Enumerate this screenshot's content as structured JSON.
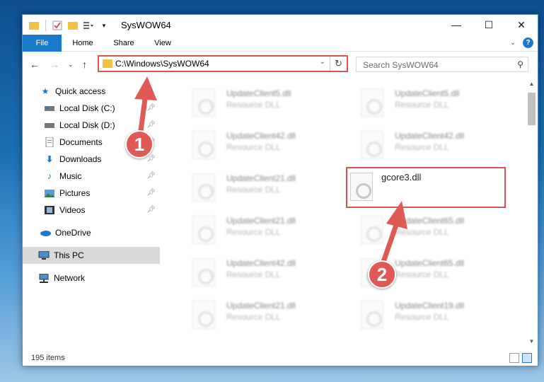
{
  "window": {
    "title": "SysWOW64"
  },
  "ribbon": {
    "tabs": [
      "File",
      "Home",
      "Share",
      "View"
    ]
  },
  "navigation": {
    "address": "C:\\Windows\\SysWOW64",
    "search_placeholder": "Search SysWOW64"
  },
  "sidebar": {
    "items": [
      {
        "label": "Quick access",
        "icon": "star-icon",
        "pinned": false
      },
      {
        "label": "Local Disk (C:)",
        "icon": "drive-icon",
        "pinned": true
      },
      {
        "label": "Local Disk (D:)",
        "icon": "drive-icon",
        "pinned": true
      },
      {
        "label": "Documents",
        "icon": "documents-icon",
        "pinned": true
      },
      {
        "label": "Downloads",
        "icon": "download-arrow-icon",
        "pinned": true
      },
      {
        "label": "Music",
        "icon": "music-note-icon",
        "pinned": true
      },
      {
        "label": "Pictures",
        "icon": "pictures-icon",
        "pinned": true
      },
      {
        "label": "Videos",
        "icon": "film-icon",
        "pinned": true
      },
      {
        "label": "OneDrive",
        "icon": "cloud-icon",
        "pinned": false
      },
      {
        "label": "This PC",
        "icon": "monitor-icon",
        "pinned": false,
        "selected": true
      },
      {
        "label": "Network",
        "icon": "network-icon",
        "pinned": false
      }
    ]
  },
  "files": [
    {
      "name": "UpdateClient5.dll",
      "type": "Resource DLL",
      "blurred": true
    },
    {
      "name": "UpdateClient5.dll",
      "type": "Resource DLL",
      "blurred": true
    },
    {
      "name": "UpdateClient42.dll",
      "type": "Resource DLL",
      "blurred": true
    },
    {
      "name": "UpdateClient42.dll",
      "type": "Resource DLL",
      "blurred": true
    },
    {
      "name": "UpdateClient21.dll",
      "type": "Resource DLL",
      "blurred": true
    },
    {
      "name": "gcore3.dll",
      "type": "",
      "blurred": false
    },
    {
      "name": "UpdateClient21.dll",
      "type": "Resource DLL",
      "blurred": true
    },
    {
      "name": "UpdateClient65.dll",
      "type": "Resource DLL",
      "blurred": true
    },
    {
      "name": "UpdateClient42.dll",
      "type": "Resource DLL",
      "blurred": true
    },
    {
      "name": "UpdateClient65.dll",
      "type": "Resource DLL",
      "blurred": true
    },
    {
      "name": "UpdateClient21.dll",
      "type": "Resource DLL",
      "blurred": true
    },
    {
      "name": "UpdateClient19.dll",
      "type": "Resource DLL",
      "blurred": true
    }
  ],
  "status": {
    "item_count": "195 items"
  },
  "callouts": {
    "first": "1",
    "second": "2"
  },
  "colors": {
    "accent": "#1979ca",
    "highlight": "#d9534f",
    "callout": "#e05a55"
  }
}
